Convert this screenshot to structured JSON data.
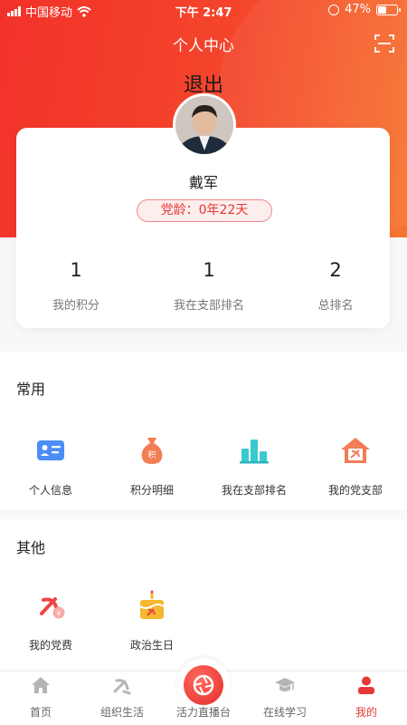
{
  "status_bar": {
    "carrier": "中国移动",
    "time": "下午 2:47",
    "battery": "47%",
    "battery_level": 0.47
  },
  "header": {
    "title": "个人中心",
    "logout": "退出"
  },
  "profile": {
    "name": "戴军",
    "party_age": "党龄：0年22天"
  },
  "stats": [
    {
      "value": "1",
      "label": "我的积分"
    },
    {
      "value": "1",
      "label": "我在支部排名"
    },
    {
      "value": "2",
      "label": "总排名"
    }
  ],
  "common": {
    "title": "常用",
    "items": [
      {
        "label": "个人信息",
        "icon": "id-card-icon"
      },
      {
        "label": "积分明细",
        "icon": "money-bag-icon"
      },
      {
        "label": "我在支部排名",
        "icon": "bar-rank-icon"
      },
      {
        "label": "我的党支部",
        "icon": "party-house-icon"
      }
    ]
  },
  "other": {
    "title": "其他",
    "items": [
      {
        "label": "我的党费",
        "icon": "party-fee-icon"
      },
      {
        "label": "政治生日",
        "icon": "birthday-cake-icon"
      }
    ]
  },
  "tabs": [
    {
      "label": "首页",
      "icon": "home-icon"
    },
    {
      "label": "组织生活",
      "icon": "party-emblem-icon"
    },
    {
      "label": "活力直播台",
      "icon": "camera-aperture-icon"
    },
    {
      "label": "在线学习",
      "icon": "graduation-cap-icon"
    },
    {
      "label": "我的",
      "icon": "person-icon",
      "active": true
    }
  ],
  "colors": {
    "primary": "#e53935",
    "gradient_start": "#f2322a",
    "gradient_end": "#f7752f"
  }
}
